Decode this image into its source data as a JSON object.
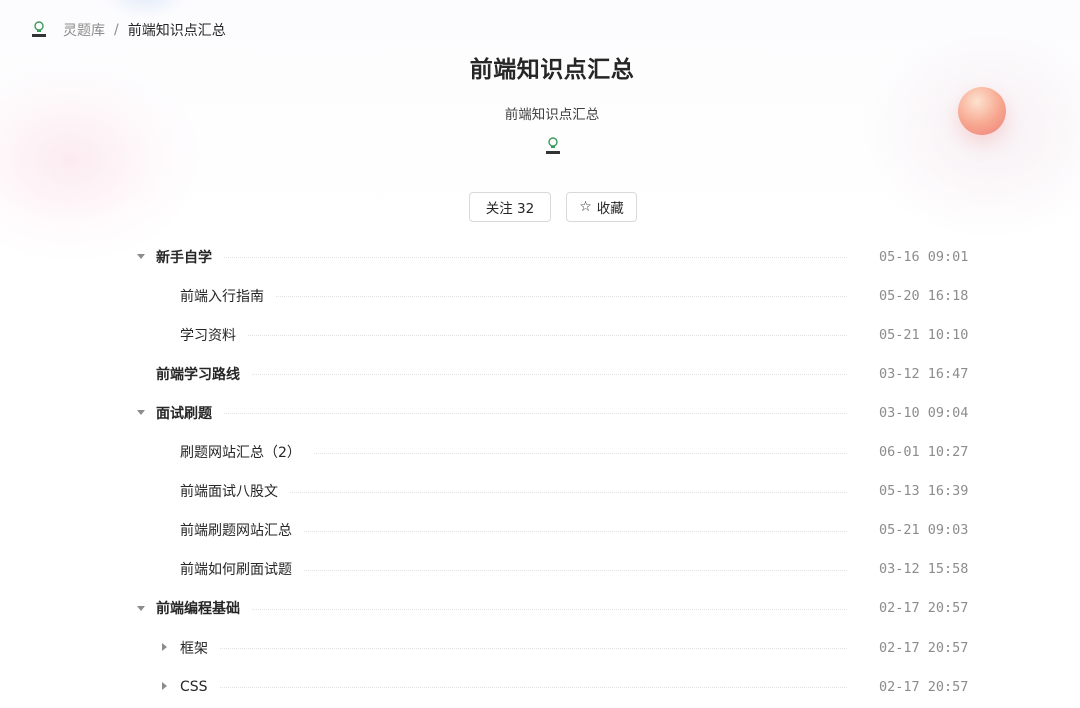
{
  "breadcrumb": {
    "root": "灵题库",
    "separator": "/",
    "current": "前端知识点汇总"
  },
  "header": {
    "title": "前端知识点汇总",
    "description": "前端知识点汇总",
    "logo_icon": "lightbulb-logo-icon"
  },
  "actions": {
    "follow_label": "关注 32",
    "favorite_label": "收藏",
    "favorite_icon": "star-outline-icon"
  },
  "colors": {
    "orb_accent": "#f49b8a",
    "logo_green": "#3a9b5c",
    "text_muted": "#8c8c8c"
  },
  "tree": [
    {
      "label": "新手自学",
      "time": "05-16 09:01",
      "level": 0,
      "bold": true,
      "toggle": "expanded"
    },
    {
      "label": "前端入行指南",
      "time": "05-20 16:18",
      "level": 1,
      "bold": false,
      "toggle": "none"
    },
    {
      "label": "学习资料",
      "time": "05-21 10:10",
      "level": 1,
      "bold": false,
      "toggle": "none"
    },
    {
      "label": "前端学习路线",
      "time": "03-12 16:47",
      "level": 0,
      "bold": true,
      "toggle": "none"
    },
    {
      "label": "面试刷题",
      "time": "03-10 09:04",
      "level": 0,
      "bold": true,
      "toggle": "expanded"
    },
    {
      "label": "刷题网站汇总（2）",
      "time": "06-01 10:27",
      "level": 1,
      "bold": false,
      "toggle": "none"
    },
    {
      "label": "前端面试八股文",
      "time": "05-13 16:39",
      "level": 1,
      "bold": false,
      "toggle": "none"
    },
    {
      "label": "前端刷题网站汇总",
      "time": "05-21 09:03",
      "level": 1,
      "bold": false,
      "toggle": "none"
    },
    {
      "label": "前端如何刷面试题",
      "time": "03-12 15:58",
      "level": 1,
      "bold": false,
      "toggle": "none"
    },
    {
      "label": "前端编程基础",
      "time": "02-17 20:57",
      "level": 0,
      "bold": true,
      "toggle": "expanded"
    },
    {
      "label": "框架",
      "time": "02-17 20:57",
      "level": 1,
      "bold": false,
      "toggle": "collapsed"
    },
    {
      "label": "CSS",
      "time": "02-17 20:57",
      "level": 1,
      "bold": false,
      "toggle": "collapsed"
    }
  ]
}
